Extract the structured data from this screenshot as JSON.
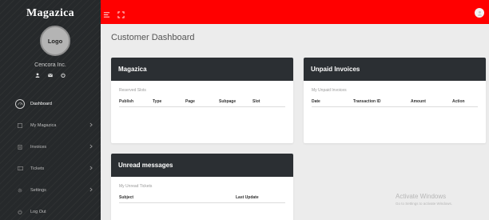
{
  "brand": "Magazica",
  "logo_label": "Logo",
  "company": "Cencora Inc.",
  "nav": [
    {
      "label": "Dashboard",
      "icon": "dashboard-icon",
      "active": true
    },
    {
      "label": "My Magazica",
      "icon": "grid-icon",
      "has_submenu": true
    },
    {
      "label": "Invoices",
      "icon": "invoice-icon",
      "has_submenu": true
    },
    {
      "label": "Tickets",
      "icon": "ticket-icon",
      "has_submenu": true
    },
    {
      "label": "Settings",
      "icon": "gear-icon",
      "has_submenu": true
    },
    {
      "label": "Log Out",
      "icon": "power-icon"
    }
  ],
  "page_title": "Customer Dashboard",
  "cards": {
    "magazica": {
      "title": "Magazica",
      "subtitle": "Reserved Slots",
      "columns": [
        "Publish",
        "Type",
        "Page",
        "Subpage",
        "Slot"
      ]
    },
    "unpaid": {
      "title": "Unpaid Invoices",
      "subtitle": "My Unpaid Invoices",
      "columns": [
        "Date",
        "Transaction ID",
        "Amount",
        "Action"
      ]
    },
    "unread": {
      "title": "Unread messages",
      "subtitle": "My Unread Tickets",
      "columns": [
        "Subject",
        "Last Update"
      ]
    }
  },
  "watermark": {
    "line1": "Activate Windows",
    "line2": "Go to Settings to activate Windows."
  },
  "colors": {
    "topbar": "#ff0000",
    "sidebar": "#26292b",
    "card_header": "#2b2f33"
  }
}
